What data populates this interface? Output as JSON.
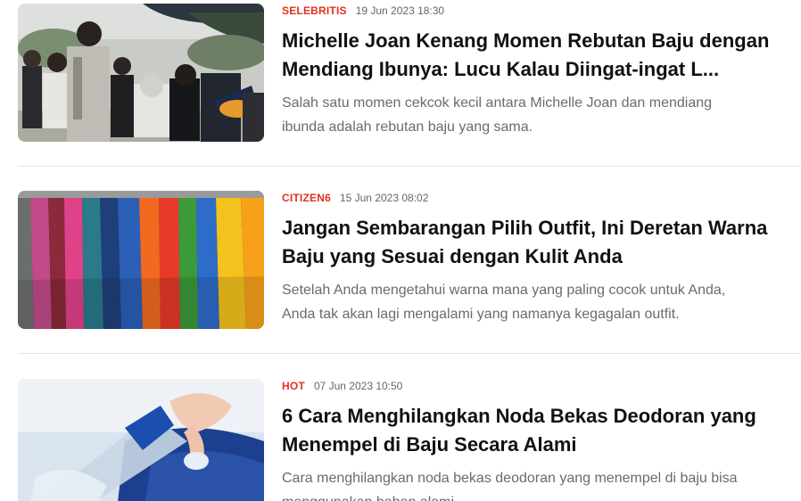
{
  "articles": [
    {
      "category": "SELEBRITIS",
      "date": "19 Jun 2023 18:30",
      "title_line1": "Michelle Joan Kenang Momen Rebutan Baju dengan",
      "title_line2": "Mendiang Ibunya: Lucu Kalau Diingat-ingat L...",
      "summary_line1": "Salah satu momen cekcok kecil antara Michelle Joan dan mendiang",
      "summary_line2": "ibunda adalah rebutan baju yang sama.",
      "thumbnail": "funeral-crowd-photo"
    },
    {
      "category": "CITIZEN6",
      "date": "15 Jun 2023 08:02",
      "title_line1": "Jangan Sembarangan Pilih Outfit, Ini Deretan Warna",
      "title_line2": "Baju yang Sesuai dengan Kulit Anda",
      "summary_line1": "Setelah Anda mengetahui warna mana yang paling cocok untuk Anda,",
      "summary_line2": "Anda tak akan lagi mengalami yang namanya kegagalan outfit.",
      "thumbnail": "colorful-hoodies-photo"
    },
    {
      "category": "HOT",
      "date": "07 Jun 2023 10:50",
      "title_line1": "6 Cara Menghilangkan Noda Bekas Deodoran yang",
      "title_line2": "Menempel di Baju Secara Alami",
      "summary_line1": "Cara menghilangkan noda bekas deodoran yang menempel di baju bisa",
      "summary_line2": "menggunakan bahan alami.",
      "thumbnail": "water-bottle-on-shirt-photo"
    }
  ],
  "colors": {
    "category": "#e4301e",
    "title": "#111111",
    "summary": "#6b6b6b",
    "date": "#666666",
    "divider": "#e6e6e6"
  }
}
